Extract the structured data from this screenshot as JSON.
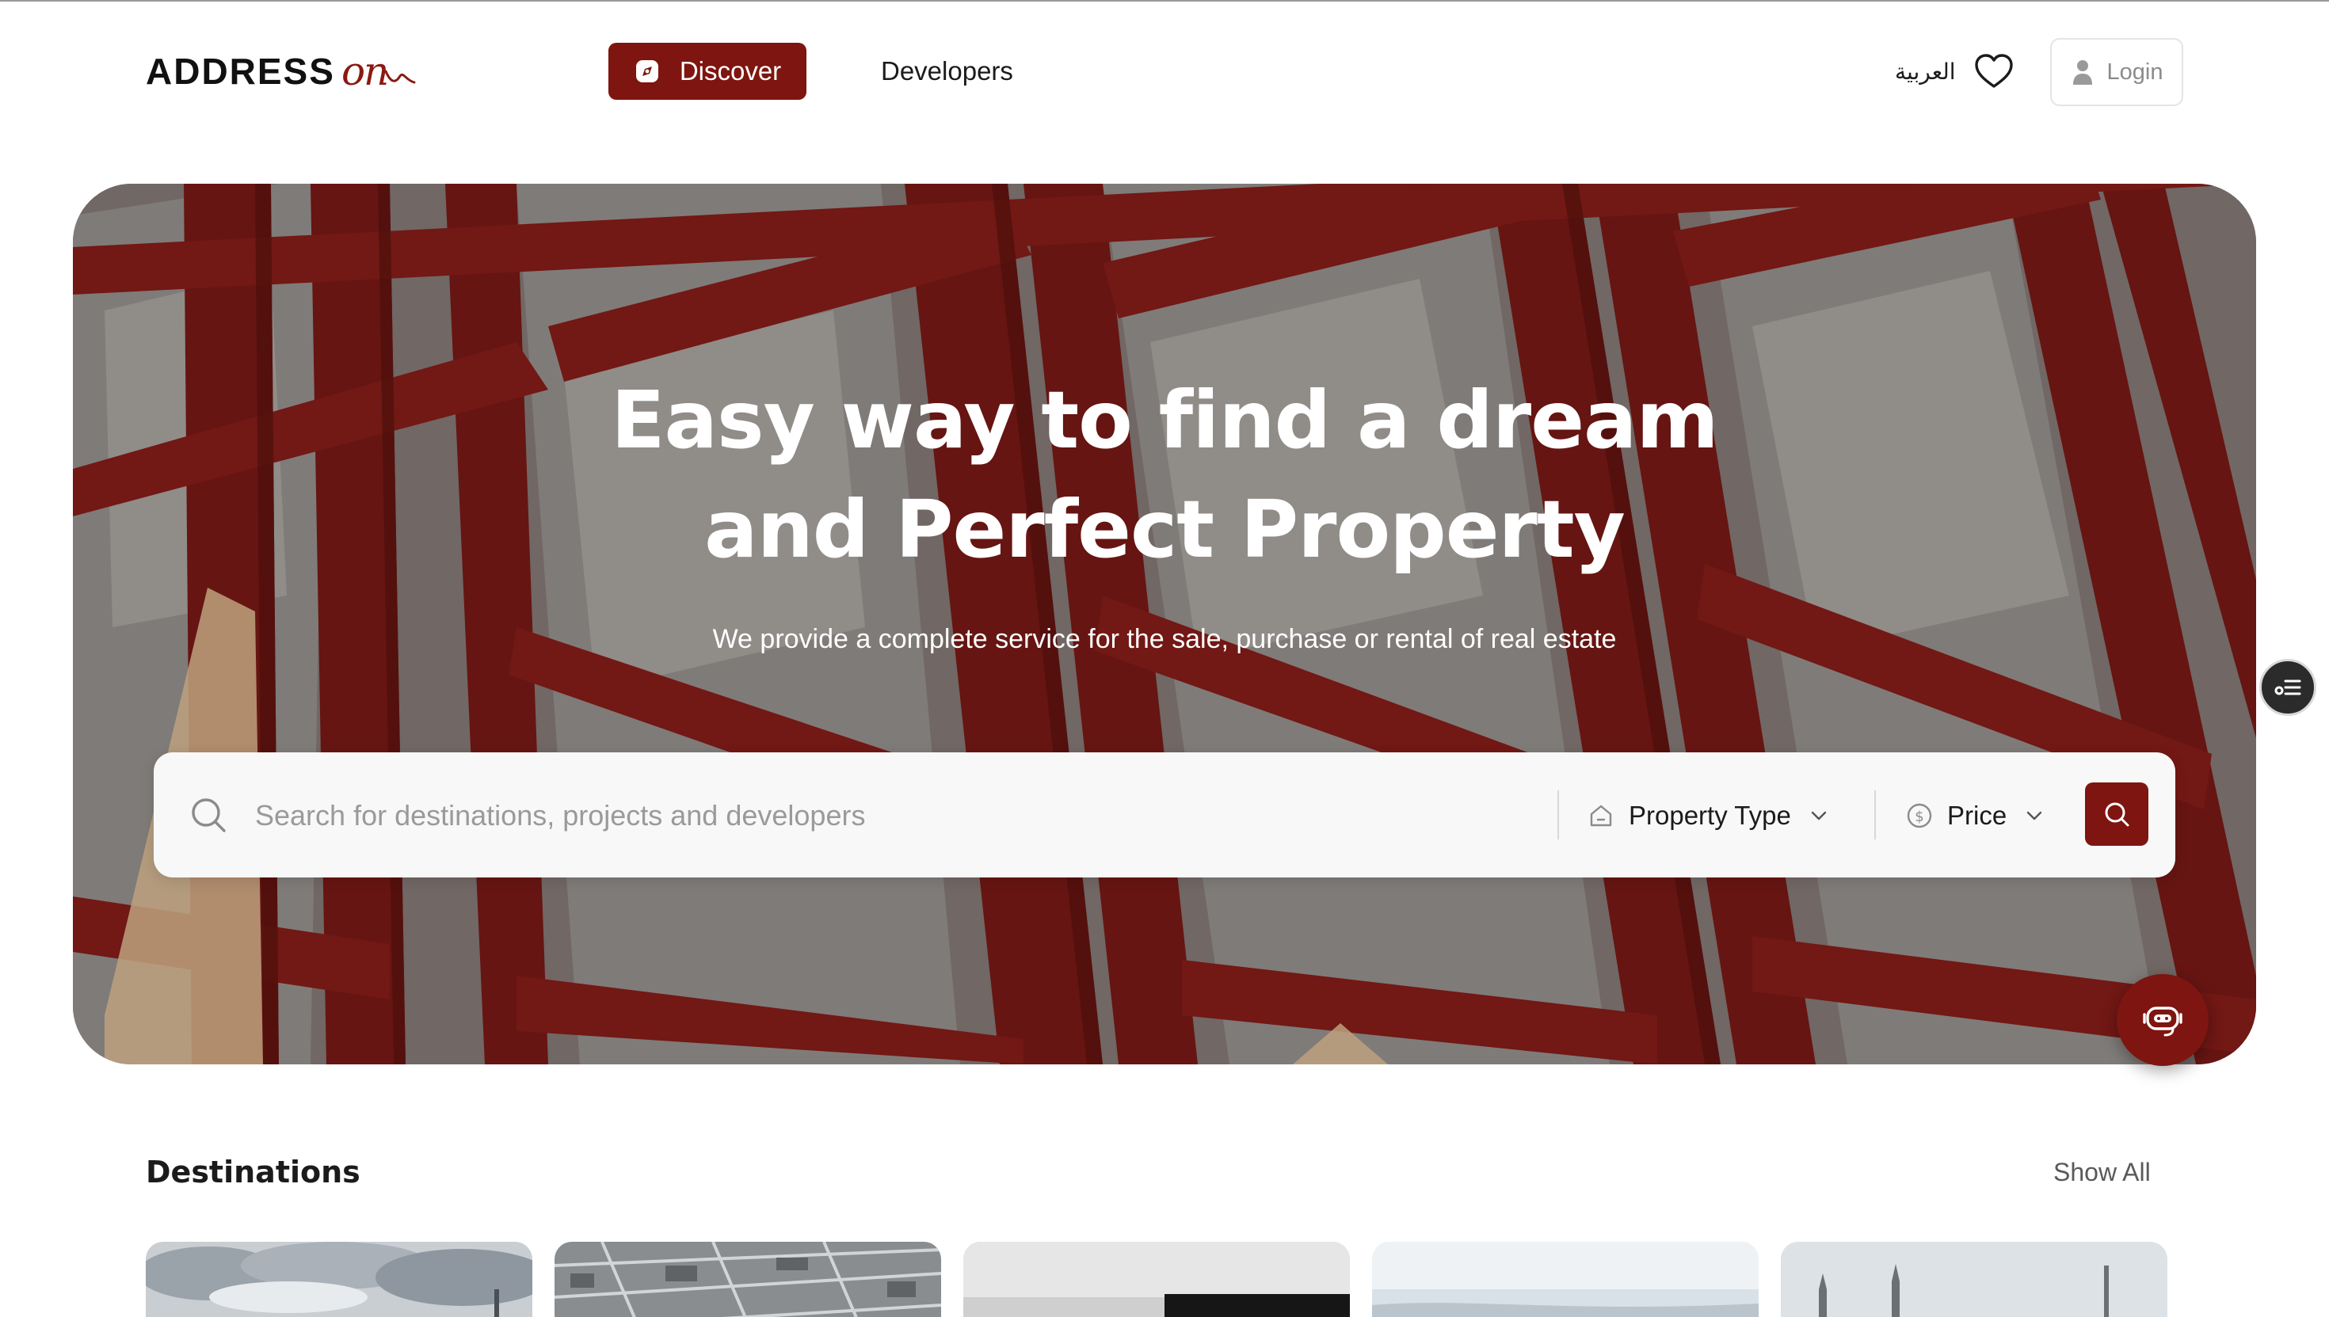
{
  "brand": {
    "word": "ADDRESS",
    "script": "on"
  },
  "nav": {
    "discover_label": "Discover",
    "developers_label": "Developers",
    "language_label": "العربية",
    "login_label": "Login"
  },
  "hero": {
    "title_line1": "Easy way to find a dream",
    "title_line2": "and Perfect Property",
    "subtitle": "We provide a complete service for the sale, purchase or rental of real estate"
  },
  "search": {
    "placeholder": "Search for destinations, projects and developers",
    "value": "",
    "property_type_label": "Property Type",
    "price_label": "Price"
  },
  "destinations": {
    "title": "Destinations",
    "show_all_label": "Show All",
    "cards": [
      {
        "icon": "cloudy-city-photo"
      },
      {
        "icon": "aerial-city-photo"
      },
      {
        "icon": "kaaba-photo"
      },
      {
        "icon": "coastline-photo"
      },
      {
        "icon": "mosque-minarets-photo"
      }
    ]
  },
  "colors": {
    "accent": "#7e1510",
    "text": "#1b1b1b",
    "muted": "#8b8b8b",
    "search_bg": "#f8f8f8"
  },
  "icons": {
    "discover": "compass-icon",
    "favorite": "heart-icon",
    "user": "user-icon",
    "search": "search-icon",
    "property_type": "house-icon",
    "price": "dollar-circle-icon",
    "side_toggle": "filter-list-icon",
    "assistant": "robot-assistant-icon"
  }
}
